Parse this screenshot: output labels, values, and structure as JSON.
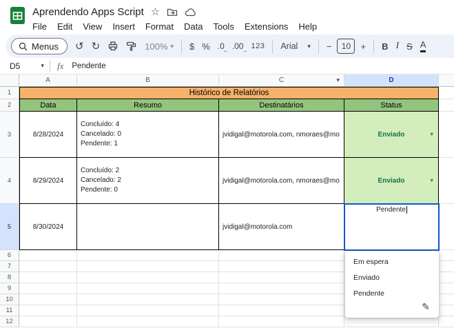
{
  "titlebar": {
    "title": "Aprendendo Apps Script",
    "menus": [
      "File",
      "Edit",
      "View",
      "Insert",
      "Format",
      "Data",
      "Tools",
      "Extensions",
      "Help"
    ]
  },
  "toolbar": {
    "menus_label": "Menus",
    "undo": "↺",
    "redo": "↻",
    "zoom_value": "100%",
    "currency": "$",
    "percent": "%",
    "decimal_decrease": ".0",
    "decimal_decrease_arrow": "←",
    "decimal_increase": ".00",
    "decimal_increase_arrow": "→",
    "number_format": "123",
    "font_name": "Arial",
    "minus": "−",
    "font_size": "10",
    "plus": "+",
    "bold": "B",
    "italic": "I",
    "strikethrough": "S",
    "text_color": "A",
    "caret": "▾"
  },
  "formula_bar": {
    "cell_ref": "D5",
    "fx_label": "fx",
    "value": "Pendente"
  },
  "grid": {
    "col_letters": [
      "A",
      "B",
      "C",
      "D"
    ],
    "row_numbers": [
      "1",
      "2",
      "3",
      "4",
      "5",
      "6",
      "7",
      "8",
      "9",
      "10",
      "11",
      "12"
    ],
    "title_row": "Histórico de Relatórios",
    "headers": [
      "Data",
      "Resumo",
      "Destinatários",
      "Status"
    ],
    "rows": [
      {
        "date": "8/28/2024",
        "summary": "Concluído: 4\nCancelado: 0\nPendente: 1",
        "recipients": "jvidigal@motorola.com, nmoraes@mo",
        "status": "Enviado"
      },
      {
        "date": "8/29/2024",
        "summary": "Concluído: 2\nCancelado: 2\nPendente: 0",
        "recipients": "jvidigal@motorola.com, nmoraes@mo",
        "status": "Enviado"
      },
      {
        "date": "8/30/2024",
        "summary": "",
        "recipients": "jvidigal@motorola.com",
        "status": ""
      }
    ],
    "edit_cell": {
      "ref": "D5",
      "value": "Pendente"
    }
  },
  "dropdown": {
    "options": [
      "Em espera",
      "Enviado",
      "Pendente"
    ]
  },
  "colors": {
    "accent_blue": "#0b57d0",
    "title_row_bg": "#f6b26b",
    "header_row_bg": "#93c47d",
    "status_chip_bg": "#d4edbc",
    "status_chip_text": "#11734b",
    "selection_bg": "#d3e3fd",
    "toolbar_bg": "#edf2fa",
    "sheets_green": "#188038"
  }
}
